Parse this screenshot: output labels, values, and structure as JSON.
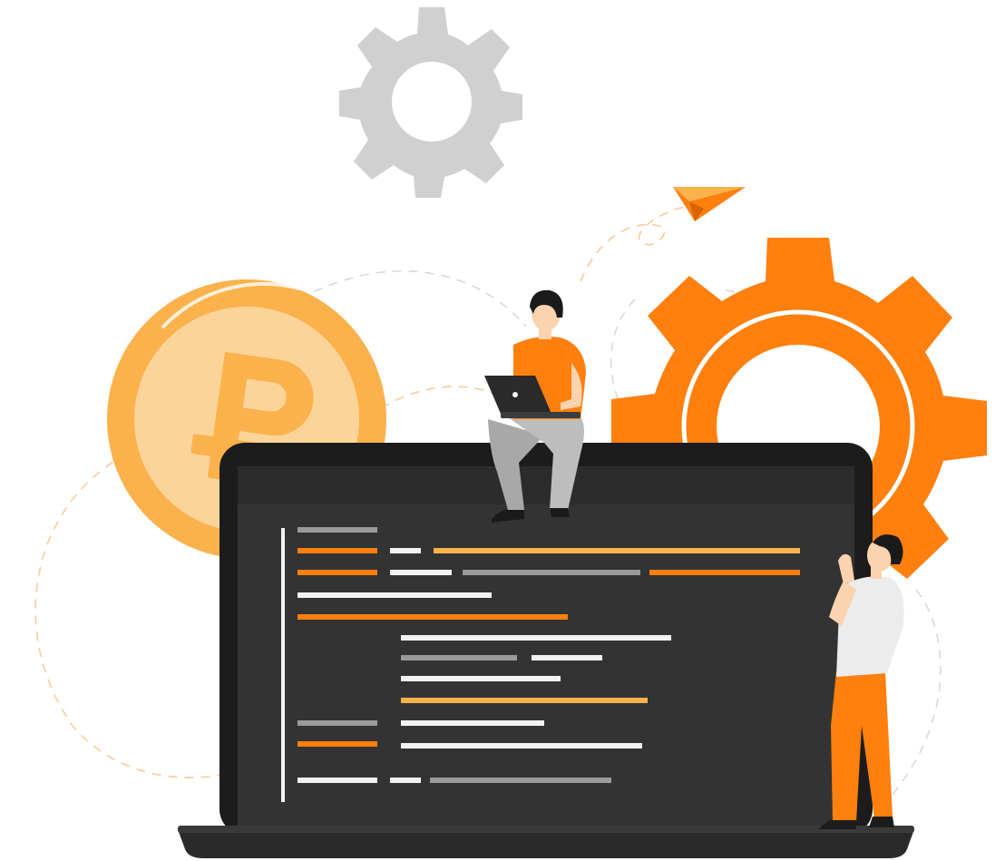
{
  "illustration": {
    "colors": {
      "orange": "#ff7f0f",
      "orange_light": "#fbb24c",
      "coin_face": "#fcd49a",
      "gray_gear": "#d0d0d0",
      "screen_bg": "#333333",
      "screen_bezel": "#1c1c1c",
      "laptop_base": "#2a2a2a",
      "code_white": "#f2f2f2",
      "code_gray": "#9a9a9a",
      "code_yellow": "#f7b24a",
      "skin": "#fbd3ae",
      "hair": "#1a1a1a",
      "pants_gray": "#a8a8a8",
      "shirt_light": "#ececec",
      "dash_line": "#d8d8d8"
    },
    "icons": [
      "gear-icon",
      "paper-plane-icon",
      "ruble-coin-icon",
      "laptop-icon"
    ]
  }
}
